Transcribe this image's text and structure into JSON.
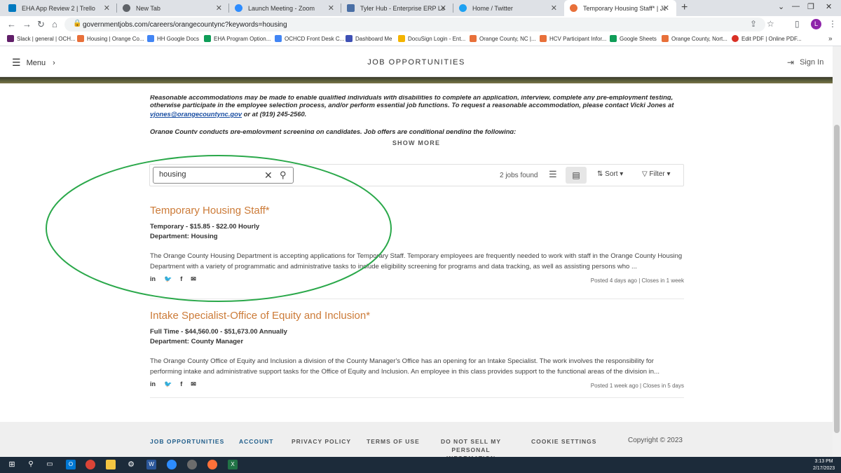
{
  "tabs": [
    {
      "label": "EHA App Review 2 | Trello",
      "color": "#0079bf"
    },
    {
      "label": "New Tab",
      "color": "#5f6368"
    },
    {
      "label": "Launch Meeting - Zoom",
      "color": "#2d8cff"
    },
    {
      "label": "Tyler Hub - Enterprise ERP Landing",
      "color": "#4a6fa5"
    },
    {
      "label": "Home / Twitter",
      "color": "#1da1f2"
    },
    {
      "label": "Temporary Housing Staff* | Job Det",
      "color": "#e8703a"
    }
  ],
  "address": {
    "url": "governmentjobs.com/careers/orangecountync?keywords=housing"
  },
  "profile_initial": "L",
  "bookmarks": [
    {
      "label": "Slack | general | OCH...",
      "color": "#611f69"
    },
    {
      "label": "Housing | Orange Co...",
      "color": "#e8703a"
    },
    {
      "label": "HH Google Docs",
      "color": "#4285f4"
    },
    {
      "label": "EHA Program Option...",
      "color": "#0f9d58"
    },
    {
      "label": "OCHCD Front Desk C...",
      "color": "#4285f4"
    },
    {
      "label": "Dashboard Me",
      "color": "#3f51b5"
    },
    {
      "label": "DocuSign Login - Ent...",
      "color": "#f4b400"
    },
    {
      "label": "Orange County, NC |...",
      "color": "#e8703a"
    },
    {
      "label": "HCV Participant Infor...",
      "color": "#e8703a"
    },
    {
      "label": "Google Sheets",
      "color": "#0f9d58"
    },
    {
      "label": "Orange County, Nort...",
      "color": "#e8703a"
    },
    {
      "label": "Edit PDF | Online PDF...",
      "color": "#d93025"
    }
  ],
  "header": {
    "menu_label": "Menu",
    "title": "JOB OPPORTUNITIES",
    "signin_label": "Sign In"
  },
  "description": {
    "line1": "Reasonable accommodations may be made to enable qualified individuals with disabilities to complete an application, interview, complete any pre-employment testing,",
    "line2": "otherwise participate in the employee selection process, and/or perform essential job functions. To request a reasonable accommodation, please contact Vicki Jones at",
    "email": "vjones@orangecountync.gov",
    "phone_text": " or at (919) 245-2560.",
    "line4": "Orange County conducts pre-employment screening on candidates.  Job offers are conditional pending the following:",
    "show_more": "SHOW MORE"
  },
  "search": {
    "value": "housing",
    "jobs_found": "2 jobs found",
    "sort_label": "Sort",
    "filter_label": "Filter"
  },
  "jobs": [
    {
      "title": "Temporary Housing Staff*",
      "type_salary": "Temporary - $15.85 - $22.00 Hourly",
      "department": "Department: Housing",
      "description": "The Orange County Housing Department is accepting applications for Temporary Staff.  Temporary employees are frequently needed to work with staff in the Orange County Housing Department with a variety of programmatic and administrative tasks to include eligibility screening for programs and data tracking, as well as assisting persons who ...",
      "posted": "Posted 4 days ago | Closes in 1 week"
    },
    {
      "title": "Intake Specialist-Office of Equity and Inclusion*",
      "type_salary": "Full Time - $44,560.00 - $51,673.00 Annually",
      "department": "Department: County Manager",
      "description": "The Orange County Office of Equity and Inclusion a division of the County Manager's Office has an opening for an Intake Specialist. The work involves the responsibility for performing intake and administrative support tasks for the Office of Equity and Inclusion. An employee in this class provides support to the functional areas of the division in...",
      "posted": "Posted 1 week ago | Closes in 5 days"
    }
  ],
  "share": {
    "linkedin": "in",
    "twitter": "🐦",
    "facebook": "f",
    "email": "✉"
  },
  "footer": {
    "links": [
      "JOB OPPORTUNITIES",
      "ACCOUNT",
      "PRIVACY POLICY",
      "TERMS OF USE",
      "DO NOT SELL MY PERSONAL INFORMATION",
      "COOKIE SETTINGS"
    ],
    "copyright": "Copyright © 2023"
  },
  "taskbar": {
    "time": "3:13 PM",
    "date": "2/17/2023"
  },
  "colors": {
    "accent": "#cc7b38",
    "link_blue": "#1f5d8a",
    "annotation_green": "#2aa84a"
  }
}
